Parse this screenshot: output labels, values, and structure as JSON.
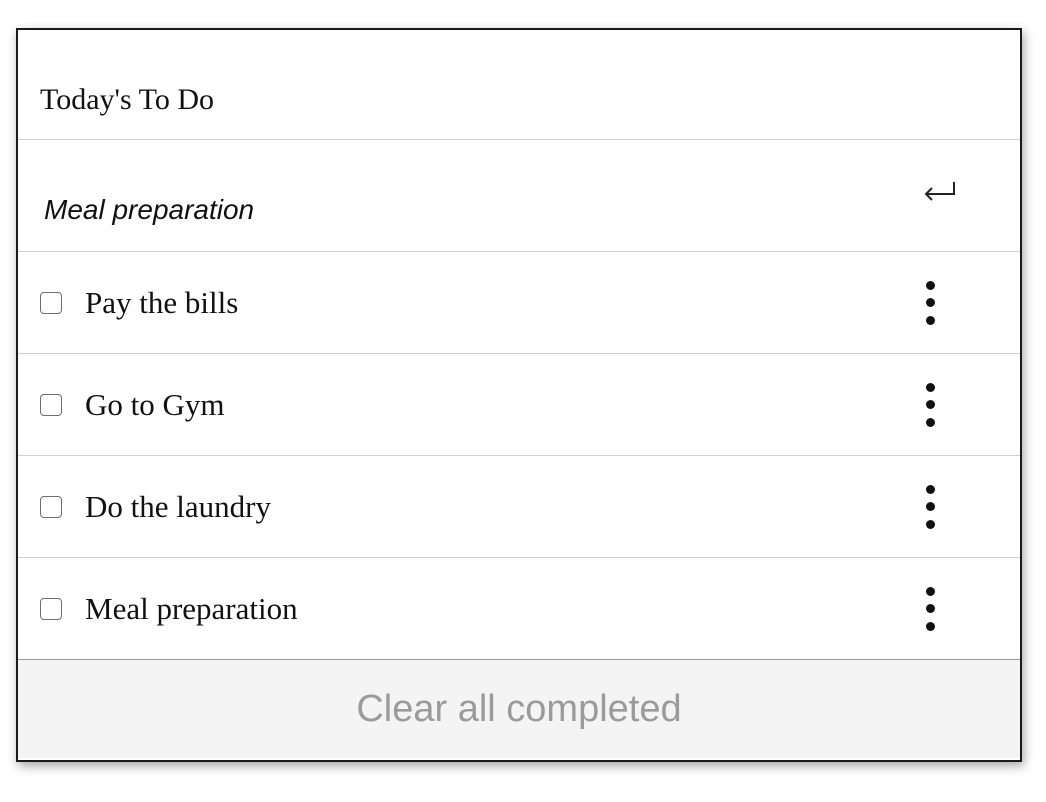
{
  "header": {
    "title": "Today's To Do"
  },
  "entry": {
    "value": "Meal preparation",
    "submit_icon": "enter-return-icon"
  },
  "todos": [
    {
      "label": "Pay the bills",
      "checked": false,
      "menu_icon": "more-vertical-icon"
    },
    {
      "label": "Go to Gym",
      "checked": false,
      "menu_icon": "more-vertical-icon"
    },
    {
      "label": "Do the laundry",
      "checked": false,
      "menu_icon": "more-vertical-icon"
    },
    {
      "label": "Meal preparation",
      "checked": false,
      "menu_icon": "more-vertical-icon"
    }
  ],
  "footer": {
    "clear_label": "Clear all completed"
  },
  "colors": {
    "border": "#1a1a1a",
    "divider": "#cfcfcf",
    "footer_bg": "#f4f4f4",
    "footer_text": "#9b9b9b"
  }
}
